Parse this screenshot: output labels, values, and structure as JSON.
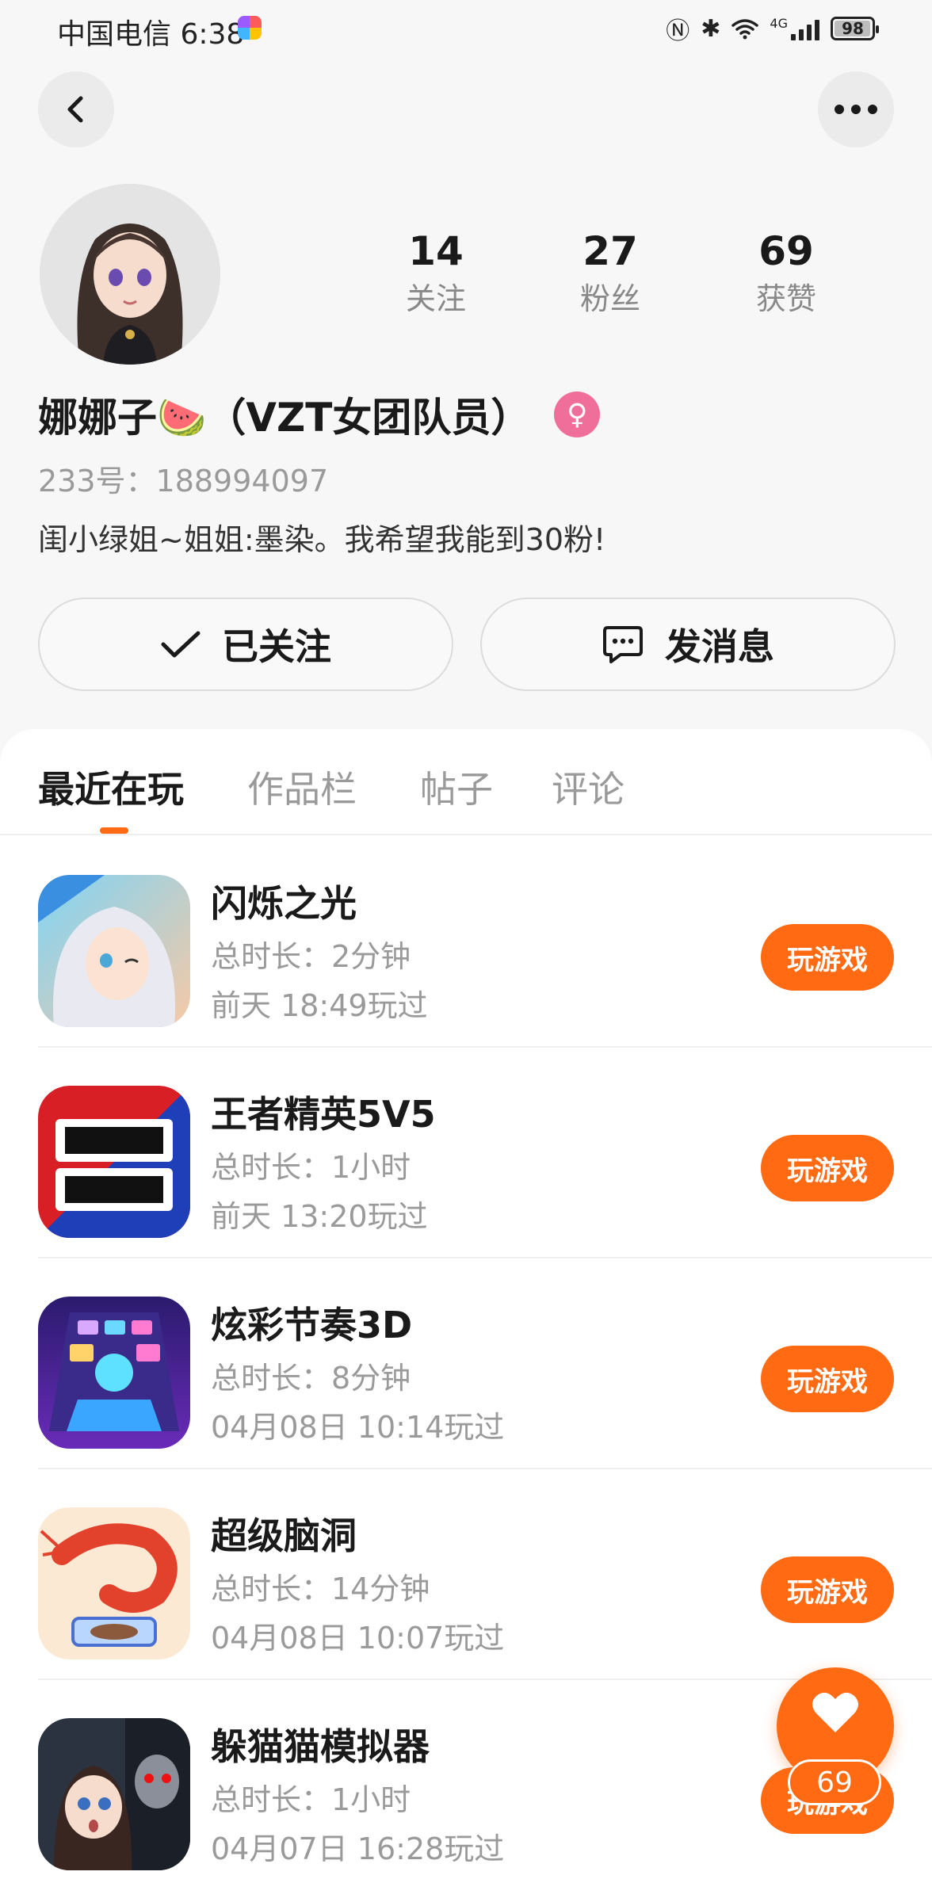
{
  "status_bar": {
    "carrier_time": "中国电信 6:38",
    "network": "4G",
    "battery": "98",
    "battery_level": 0.98
  },
  "nav": {
    "back_icon": "chevron-left-icon",
    "more_icon": "more-horizontal-icon"
  },
  "profile": {
    "nickname": "娜娜子🍉（VZT女团队员）",
    "gender_symbol": "♀",
    "user_id": "233号：188994097",
    "bio": "闺小绿姐~姐姐:墨染。我希望我能到30粉!",
    "stats": [
      {
        "value": "14",
        "label": "关注"
      },
      {
        "value": "27",
        "label": "粉丝"
      },
      {
        "value": "69",
        "label": "获赞"
      }
    ]
  },
  "actions": {
    "follow_label": "已关注",
    "message_label": "发消息"
  },
  "tabs": [
    {
      "label": "最近在玩",
      "active": true
    },
    {
      "label": "作品栏",
      "active": false
    },
    {
      "label": "帖子",
      "active": false
    },
    {
      "label": "评论",
      "active": false
    }
  ],
  "games": [
    {
      "title": "闪烁之光",
      "duration": "总时长：2分钟",
      "last_played": "前天 18:49玩过",
      "button": "玩游戏",
      "icon": "anime-girl-icon"
    },
    {
      "title": "王者精英5V5",
      "duration": "总时长：1小时",
      "last_played": "前天 13:20玩过",
      "button": "玩游戏",
      "icon": "wangzhe-5v5-icon"
    },
    {
      "title": "炫彩节奏3D",
      "duration": "总时长：8分钟",
      "last_played": "04月08日 10:14玩过",
      "button": "玩游戏",
      "icon": "rhythm-tiles-icon"
    },
    {
      "title": "超级脑洞",
      "duration": "总时长：14分钟",
      "last_played": "04月08日 10:07玩过",
      "button": "玩游戏",
      "icon": "shrimp-icon"
    },
    {
      "title": "躲猫猫模拟器",
      "duration": "总时长：1小时",
      "last_played": "04月07日 16:28玩过",
      "button": "玩游戏",
      "icon": "hide-and-seek-icon"
    }
  ],
  "like_fab": {
    "count": "69",
    "icon": "heart-icon"
  },
  "colors": {
    "accent": "#ff6a13",
    "gender": "#f06e9a",
    "muted_text": "#9a9a9a"
  }
}
